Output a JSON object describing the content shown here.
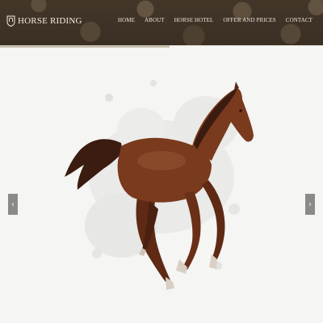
{
  "header": {
    "brand_name": "HORSE RIDING",
    "logo_icon": "horseshoe-shield-icon"
  },
  "nav": {
    "items": [
      {
        "label": "HOME"
      },
      {
        "label": "ABOUT"
      },
      {
        "label": "HORSE HOTEL"
      },
      {
        "label": "OFFER AND PRICES"
      },
      {
        "label": "CONTACT"
      }
    ]
  },
  "slider": {
    "image": "galloping-chestnut-horse",
    "prev_icon": "chevron-left-icon",
    "next_icon": "chevron-right-icon",
    "prev_glyph": "‹",
    "next_glyph": "›"
  },
  "colors": {
    "header_overlay": "#2f241b",
    "nav_text": "#ece5db",
    "horse_body": "#7a3a1e",
    "arrow_bg": "#8a8a86"
  }
}
